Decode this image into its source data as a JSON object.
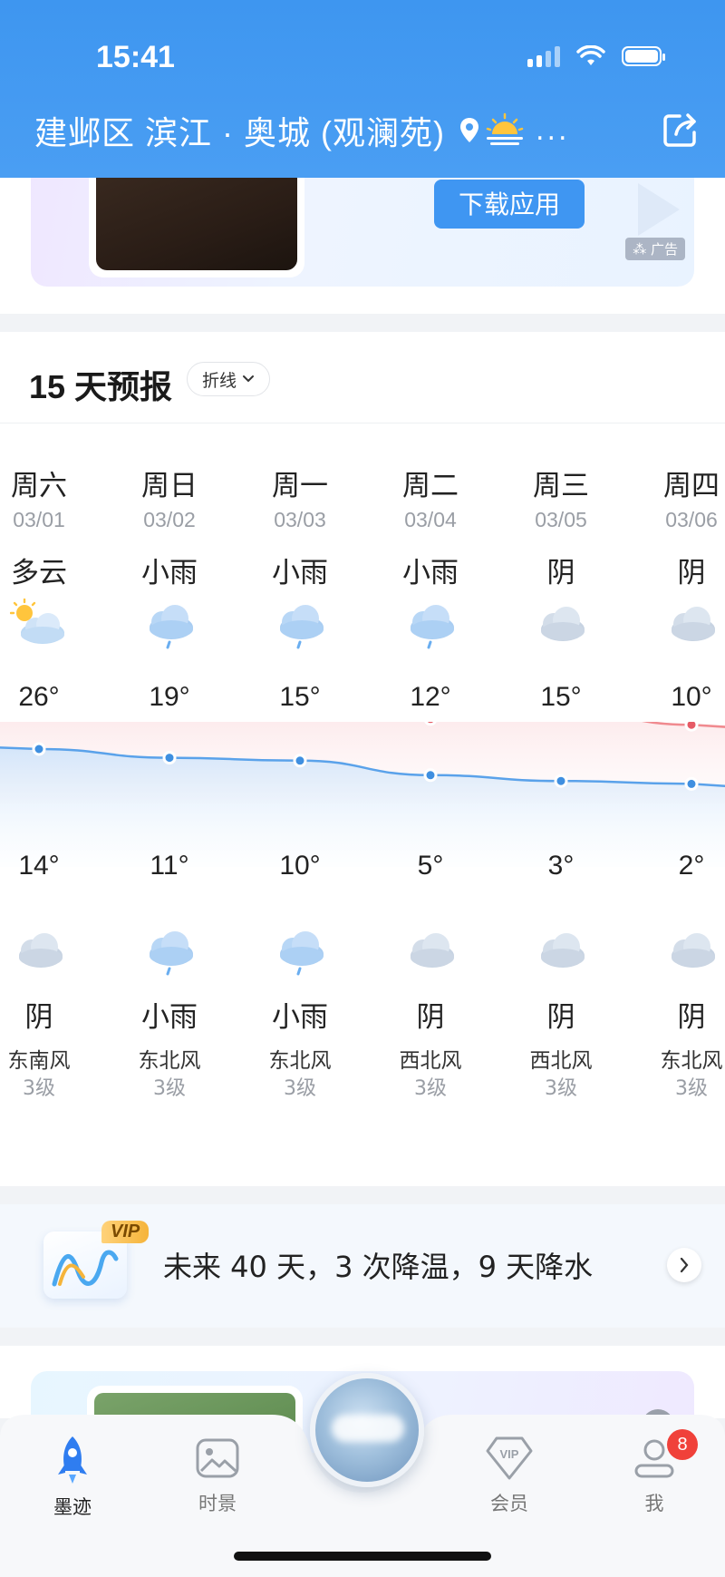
{
  "status_bar": {
    "time": "15:41"
  },
  "header": {
    "location": "建邺区 滨江 · 奥城 (观澜苑)",
    "more": "..."
  },
  "ad_top": {
    "download_label": "下载应用",
    "ad_tag": "广告"
  },
  "forecast": {
    "title": "15 天预报",
    "view_toggle": "折线",
    "days": [
      {
        "weekday": "周六",
        "date": "03/01",
        "day_condition": "多云",
        "day_icon": "partly-cloudy-icon",
        "high": "26°",
        "low": "14°",
        "night_icon": "cloudy-icon",
        "night_condition": "阴",
        "wind_dir": "东南风",
        "wind_level": "3级"
      },
      {
        "weekday": "周日",
        "date": "03/02",
        "day_condition": "小雨",
        "day_icon": "light-rain-icon",
        "high": "19°",
        "low": "11°",
        "night_icon": "light-rain-icon",
        "night_condition": "小雨",
        "wind_dir": "东北风",
        "wind_level": "3级"
      },
      {
        "weekday": "周一",
        "date": "03/03",
        "day_condition": "小雨",
        "day_icon": "light-rain-icon",
        "high": "15°",
        "low": "10°",
        "night_icon": "light-rain-icon",
        "night_condition": "小雨",
        "wind_dir": "东北风",
        "wind_level": "3级"
      },
      {
        "weekday": "周二",
        "date": "03/04",
        "day_condition": "小雨",
        "day_icon": "light-rain-icon",
        "high": "12°",
        "low": "5°",
        "night_icon": "cloudy-icon",
        "night_condition": "阴",
        "wind_dir": "西北风",
        "wind_level": "3级"
      },
      {
        "weekday": "周三",
        "date": "03/05",
        "day_condition": "阴",
        "day_icon": "cloudy-icon",
        "high": "15°",
        "low": "3°",
        "night_icon": "cloudy-icon",
        "night_condition": "阴",
        "wind_dir": "西北风",
        "wind_level": "3级"
      },
      {
        "weekday": "周四",
        "date": "03/06",
        "day_condition": "阴",
        "day_icon": "cloudy-icon",
        "high": "10°",
        "low": "2°",
        "night_icon": "cloudy-icon",
        "night_condition": "阴",
        "wind_dir": "东北风",
        "wind_level": "3级"
      }
    ],
    "high_values": [
      26,
      19,
      15,
      12,
      15,
      10
    ],
    "low_values": [
      14,
      11,
      10,
      5,
      3,
      2
    ],
    "colors": {
      "high_line": "#f08a8f",
      "low_line": "#5aa2ea"
    }
  },
  "vip_banner": {
    "badge": "VIP",
    "text": "未来 40 天，3 次降温，9 天降水"
  },
  "tabbar": {
    "tabs": [
      {
        "label": "墨迹",
        "icon": "rocket-icon",
        "active": true
      },
      {
        "label": "时景",
        "icon": "photo-icon",
        "active": false
      },
      {
        "label": "会员",
        "icon": "vip-diamond-icon",
        "active": false
      },
      {
        "label": "我",
        "icon": "profile-icon",
        "active": false
      }
    ],
    "me_badge": "8"
  },
  "colors": {
    "header_blue": "#4a9ef3",
    "accent": "#3f96f2",
    "badge_red": "#f0413a"
  }
}
